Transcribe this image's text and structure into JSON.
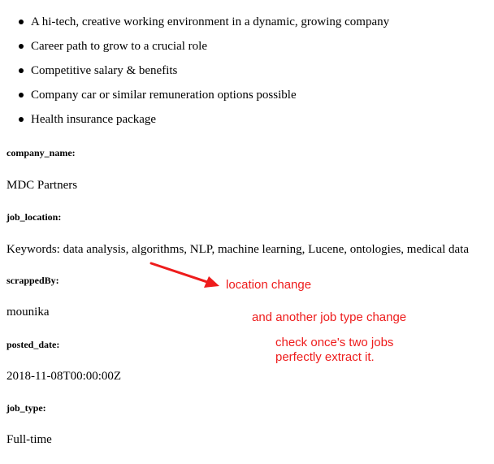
{
  "benefits": [
    "A hi-tech, creative working environment in a dynamic, growing company",
    "Career path to grow to a crucial role",
    "Competitive salary & benefits",
    "Company car or similar remuneration options possible",
    "Health insurance package"
  ],
  "fields": {
    "company_name": {
      "label": "company_name:",
      "value": "MDC Partners"
    },
    "job_location": {
      "label": "job_location:",
      "value": "Keywords: data analysis, algorithms, NLP, machine learning, Lucene, ontologies, medical data"
    },
    "scrappedBy": {
      "label": "scrappedBy:",
      "value": "mounika"
    },
    "posted_date": {
      "label": "posted_date:",
      "value": "2018-11-08T00:00:00Z"
    },
    "job_type": {
      "label": "job_type:",
      "value": "Full-time"
    }
  },
  "annotations": {
    "location_change": "location change",
    "job_type_change": "and another job type change",
    "check_line1": "check once's two jobs",
    "check_line2": "perfectly extract  it."
  },
  "colors": {
    "annotation": "#ee1c1c"
  }
}
